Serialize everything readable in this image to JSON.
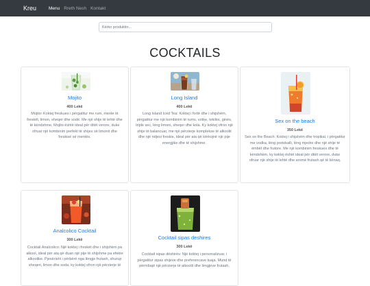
{
  "navbar": {
    "brand": "Kreu",
    "links": [
      {
        "label": "Menu",
        "active": true
      },
      {
        "label": "Rreth Nesh",
        "active": false
      },
      {
        "label": "Kontakt",
        "active": false
      }
    ]
  },
  "search": {
    "placeholder": "Kërko produktin..."
  },
  "page_title": "COCKTAILS",
  "products": [
    {
      "name": "Mojito",
      "price": "400 Lekë",
      "description": "Mojito: Koktej freskues i përgatitur me rum, mente të freskët, limon, sheqer dhe sodë. Me një shije të lehtë dhe të këndshme, Mojito është ideal për ditët verore, duke ofruar një kombinim perfekt të shijes së limonit dhe freskisë së mentës."
    },
    {
      "name": "Long Island",
      "price": "400 Lekë",
      "description": "Long Island Iced Tea: Koktej i fortë dhe i shijshëm, përgatitur me një kombinim të rums, votke, tekilës, ginës, triple sec, lëng limoni, sheqer dhe kola. Ky koktej ofron një shije të balancuar, me një përzierje komplekse të alkoolit dhe një ndjesi freskie, ideal për ata që kërkojnë një pije energjike dhe të shijshme."
    },
    {
      "name": "Sex on the beach",
      "price": "350 Lekë",
      "description": "Sex on the Beach: Koktej i shijshëm dhe tropikal, i përgatitur me vodka, lëng portokalli, lëng mjedre dhe një shije të ëmbël dhe frutore. Me një kombinim freskues dhe të këndshëm, ky koktej është ideal për ditët verore, duke ofruar një shije të lehtë dhe aromë frutash që të kënaq."
    },
    {
      "name": "Analcolico Cocktail",
      "price": "300 Lekë",
      "description": "Cocktail Analcolico: Një koktej i freskët dhe i shijshëm pa alkool, ideal për ata që duan një pije të shijshme pa efekte alkoolike. Pjesërisht i përbërë nga lëngje frutash, shurup sheqeri, limon dhe soda, ky koktej ofron një përzierje të"
    },
    {
      "name": "Cocktail sipas deshires",
      "price": "300 Lekë",
      "description": "Cocktail sipas dëshirës: Një koktej i personalizuar, i përgatitur sipas shijeve dhe preferencave tuaja. Mund të përmbajë një përzierje të alkoolit dhe lëngjeve frutash,"
    }
  ],
  "colors": {
    "navbar_bg": "#343a40",
    "link": "#1a7ae6",
    "muted_text": "#6c757d"
  }
}
